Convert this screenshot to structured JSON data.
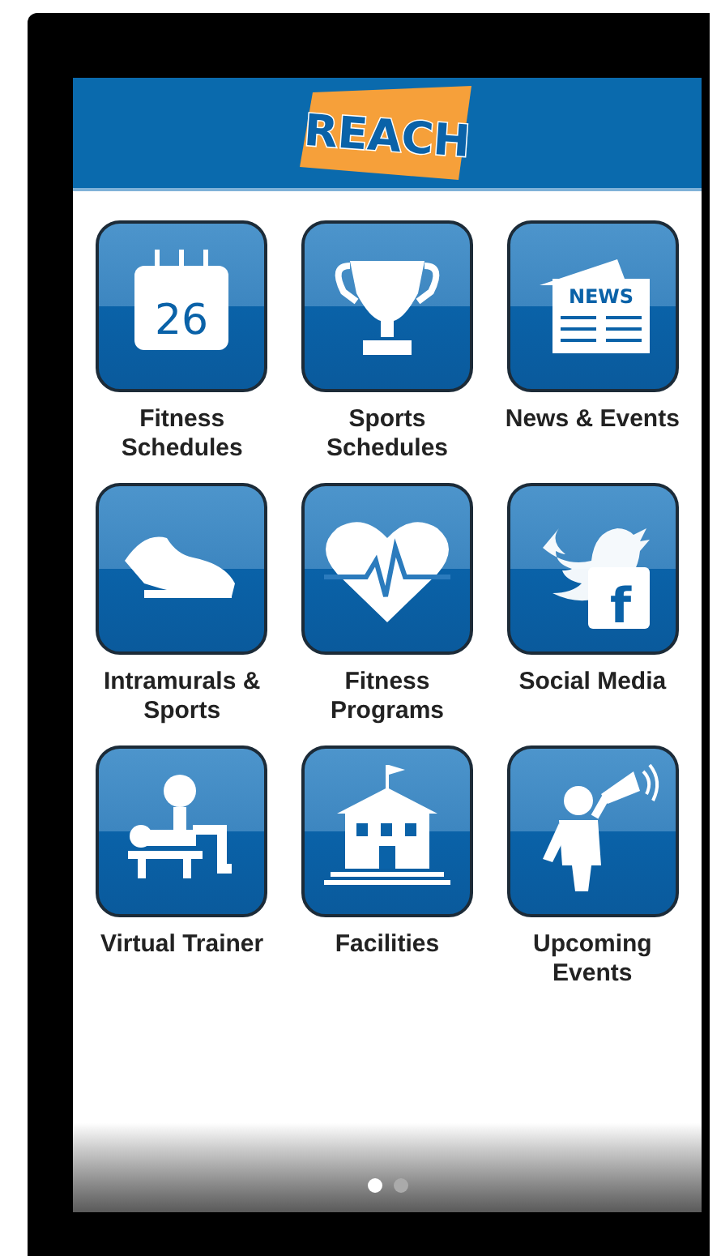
{
  "header": {
    "logo": "REACH"
  },
  "tiles": [
    {
      "kind": "calendar",
      "label": "Fitness Schedules",
      "icon_text": "26"
    },
    {
      "kind": "trophy",
      "label": "Sports Schedules"
    },
    {
      "kind": "news",
      "label": "News & Events",
      "icon_text": "NEWS"
    },
    {
      "kind": "shoe",
      "label": "Intramurals & Sports"
    },
    {
      "kind": "heart",
      "label": "Fitness Programs"
    },
    {
      "kind": "social",
      "label": "Social Media",
      "icon_text": "f"
    },
    {
      "kind": "bench",
      "label": "Virtual Trainer"
    },
    {
      "kind": "building",
      "label": "Facilities"
    },
    {
      "kind": "speaker",
      "label": "Upcoming Events"
    }
  ],
  "pages": [
    {
      "selected": true
    },
    {
      "selected": false
    }
  ]
}
